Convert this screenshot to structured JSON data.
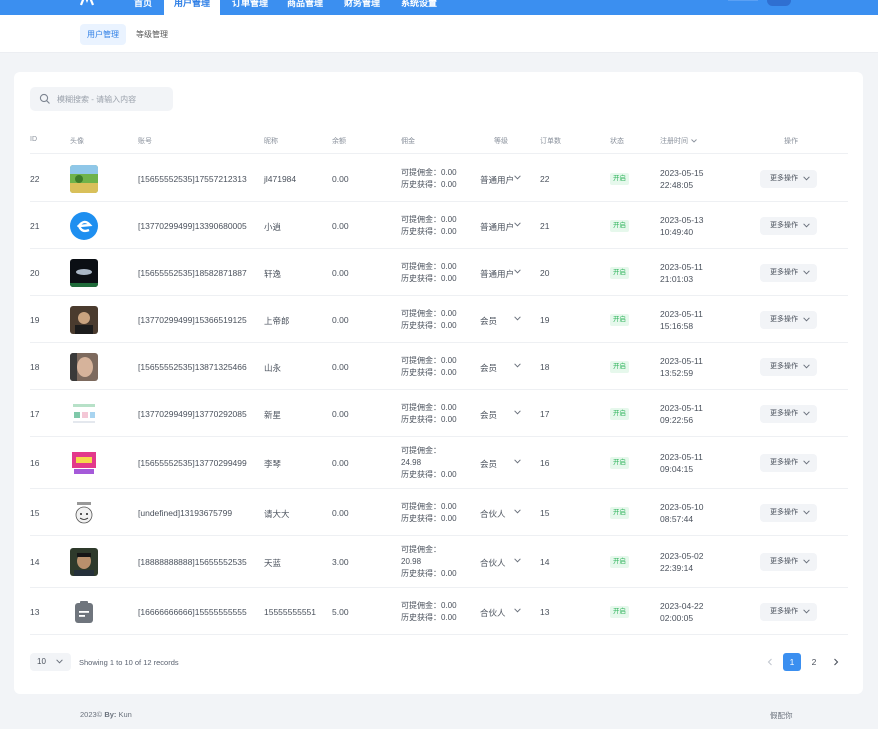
{
  "nav": {
    "items": [
      {
        "label": "首页",
        "active": false
      },
      {
        "label": "用户管理",
        "active": true
      },
      {
        "label": "订单管理",
        "active": false
      },
      {
        "label": "商品管理",
        "active": false
      },
      {
        "label": "财务管理",
        "active": false
      },
      {
        "label": "系统设置",
        "active": false
      }
    ]
  },
  "subnav": {
    "items": [
      {
        "label": "用户管理",
        "active": true
      },
      {
        "label": "等级管理",
        "active": false
      }
    ]
  },
  "search": {
    "placeholder": "模糊搜索 - 请输入内容"
  },
  "table": {
    "headers": {
      "id": "ID",
      "avatar": "头像",
      "account": "账号",
      "nickname": "昵称",
      "balance": "余额",
      "commission": "佣金",
      "grade": "等级",
      "orders": "订单数",
      "status": "状态",
      "register_time": "注册时间",
      "actions": "操作"
    },
    "rows": [
      {
        "id": "22",
        "avatar": "landscape",
        "account": "[15655552535]17557212313",
        "nickname": "jl471984",
        "balance": "0.00",
        "commission": [
          "可提佣金：0.00",
          "历史获得：0.00"
        ],
        "grade": "普通用户",
        "orders": "22",
        "status": "开启",
        "date": "2023-05-15",
        "time": "22:48:05",
        "action": "更多操作"
      },
      {
        "id": "21",
        "avatar": "blue-e",
        "account": "[13770299499]13390680005",
        "nickname": "小逍",
        "balance": "0.00",
        "commission": [
          "可提佣金：0.00",
          "历史获得：0.00"
        ],
        "grade": "普通用户",
        "orders": "21",
        "status": "开启",
        "date": "2023-05-13",
        "time": "10:49:40",
        "action": "更多操作"
      },
      {
        "id": "20",
        "avatar": "dark-ufo",
        "account": "[15655552535]18582871887",
        "nickname": "轩逸",
        "balance": "0.00",
        "commission": [
          "可提佣金：0.00",
          "历史获得：0.00"
        ],
        "grade": "普通用户",
        "orders": "20",
        "status": "开启",
        "date": "2023-05-11",
        "time": "21:01:03",
        "action": "更多操作"
      },
      {
        "id": "19",
        "avatar": "portrait-dark",
        "account": "[13770299499]15366519125",
        "nickname": "上帝郎",
        "balance": "0.00",
        "commission": [
          "可提佣金：0.00",
          "历史获得：0.00"
        ],
        "grade": "会员",
        "orders": "19",
        "status": "开启",
        "date": "2023-05-11",
        "time": "15:16:58",
        "action": "更多操作"
      },
      {
        "id": "18",
        "avatar": "portrait-face",
        "account": "[15655552535]13871325466",
        "nickname": "山永",
        "balance": "0.00",
        "commission": [
          "可提佣金：0.00",
          "历史获得：0.00"
        ],
        "grade": "会员",
        "orders": "18",
        "status": "开启",
        "date": "2023-05-11",
        "time": "13:52:59",
        "action": "更多操作"
      },
      {
        "id": "17",
        "avatar": "light-icons",
        "account": "[13770299499]13770292085",
        "nickname": "新星",
        "balance": "0.00",
        "commission": [
          "可提佣金：0.00",
          "历史获得：0.00"
        ],
        "grade": "会员",
        "orders": "17",
        "status": "开启",
        "date": "2023-05-11",
        "time": "09:22:56",
        "action": "更多操作"
      },
      {
        "id": "16",
        "avatar": "pink-poster",
        "account": "[15655552535]13770299499",
        "nickname": "李琴",
        "balance": "0.00",
        "commission": [
          "可提佣金：",
          "24.98",
          "历史获得：0.00"
        ],
        "grade": "会员",
        "orders": "16",
        "status": "开启",
        "date": "2023-05-11",
        "time": "09:04:15",
        "action": "更多操作"
      },
      {
        "id": "15",
        "avatar": "meme-face",
        "account": "[undefined]13193675799",
        "nickname": "请大大",
        "balance": "0.00",
        "commission": [
          "可提佣金：0.00",
          "历史获得：0.00"
        ],
        "grade": "合伙人",
        "orders": "15",
        "status": "开启",
        "date": "2023-05-10",
        "time": "08:57:44",
        "action": "更多操作"
      },
      {
        "id": "14",
        "avatar": "portrait-man",
        "account": "[18888888888]15655552535",
        "nickname": "天蓝",
        "balance": "3.00",
        "commission": [
          "可提佣金：",
          "20.98",
          "历史获得：0.00"
        ],
        "grade": "合伙人",
        "orders": "14",
        "status": "开启",
        "date": "2023-05-02",
        "time": "22:39:14",
        "action": "更多操作"
      },
      {
        "id": "13",
        "avatar": "clipboard",
        "account": "[16666666666]15555555555",
        "nickname": "15555555551",
        "balance": "5.00",
        "commission": [
          "可提佣金：0.00",
          "历史获得：0.00"
        ],
        "grade": "合伙人",
        "orders": "13",
        "status": "开启",
        "date": "2023-04-22",
        "time": "02:00:05",
        "action": "更多操作"
      }
    ]
  },
  "pagination": {
    "page_size": "10",
    "records_text": "Showing 1 to 10 of 12 records",
    "pages": [
      "1",
      "2"
    ],
    "current": "1"
  },
  "footer": {
    "copyright": "2023©",
    "by_label": "By:",
    "author": "Kun",
    "icp": "假配你"
  },
  "colors": {
    "primary": "#3b8ff0",
    "status_green": "#2fb35b"
  }
}
